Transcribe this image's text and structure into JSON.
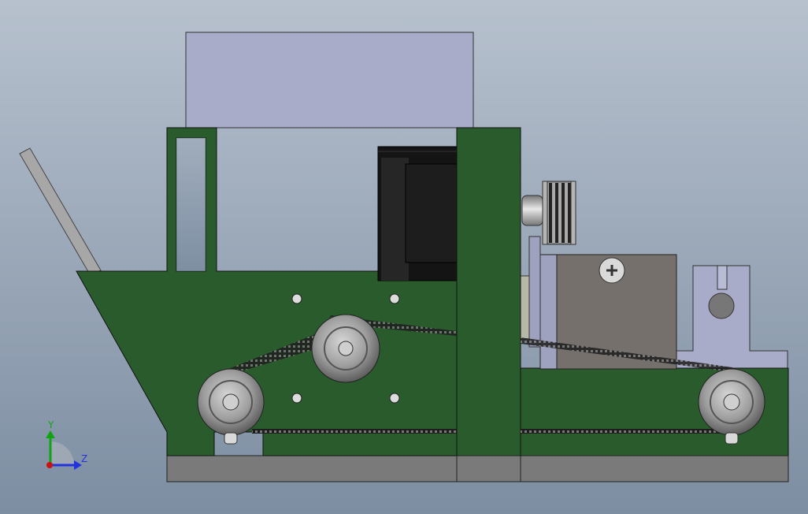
{
  "triad": {
    "y_label": "Y",
    "z_label": "Z"
  },
  "colors": {
    "background_top": "#b6c0cd",
    "background_bottom": "#7f8fa2",
    "plate_green": "#2a5b2c",
    "plate_lavender": "#a7abc9",
    "motor_black": "#141414",
    "base_gray": "#7a7a7a",
    "block_gray": "#75706c",
    "pulley_gray": "#9a9a9a",
    "triad_y": "#11a311",
    "triad_z": "#2233dd",
    "triad_x": "#cc1111"
  }
}
